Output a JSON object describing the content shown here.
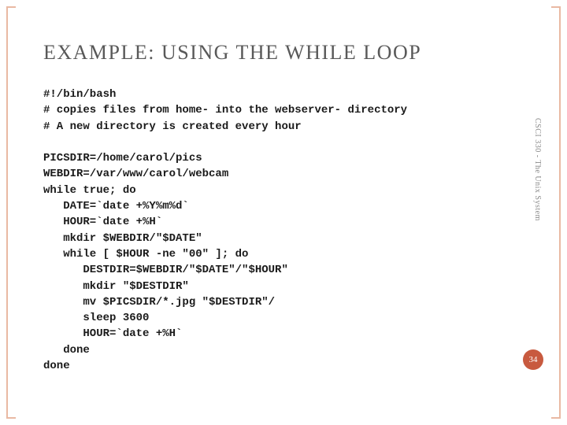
{
  "slide": {
    "title": "EXAMPLE: USING THE WHILE LOOP",
    "side_label": "CSCI 330 - The Unix System",
    "page_number": "34",
    "code": "#!/bin/bash\n# copies files from home- into the webserver- directory\n# A new directory is created every hour\n\nPICSDIR=/home/carol/pics\nWEBDIR=/var/www/carol/webcam\nwhile true; do\n   DATE=`date +%Y%m%d`\n   HOUR=`date +%H`\n   mkdir $WEBDIR/\"$DATE\"\n   while [ $HOUR -ne \"00\" ]; do\n      DESTDIR=$WEBDIR/\"$DATE\"/\"$HOUR\"\n      mkdir \"$DESTDIR\"\n      mv $PICSDIR/*.jpg \"$DESTDIR\"/\n      sleep 3600\n      HOUR=`date +%H`\n   done\ndone"
  }
}
